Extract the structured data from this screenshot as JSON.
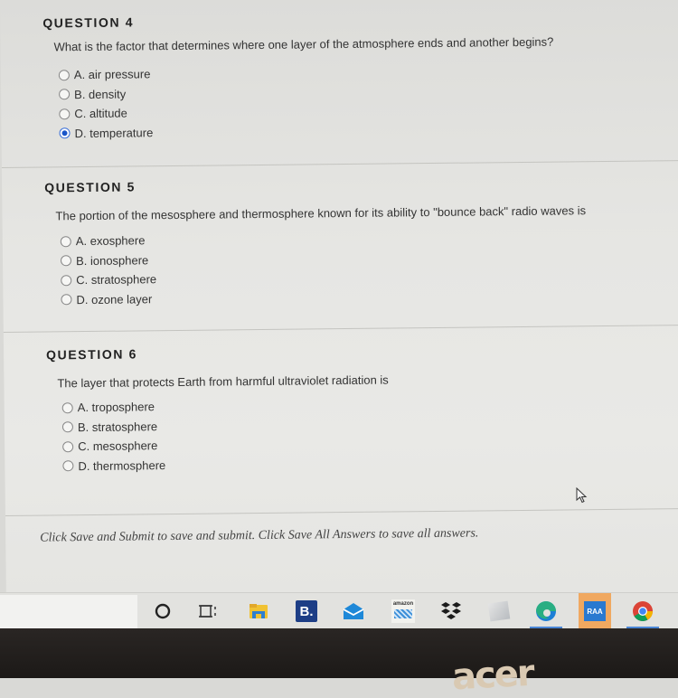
{
  "questions": [
    {
      "title": "QUESTION 4",
      "text": "What is the factor that determines where one layer of the atmosphere ends and another begins?",
      "options": [
        {
          "label": "A. air pressure",
          "selected": false
        },
        {
          "label": "B. density",
          "selected": false
        },
        {
          "label": "C. altitude",
          "selected": false
        },
        {
          "label": "D. temperature",
          "selected": true
        }
      ]
    },
    {
      "title": "QUESTION 5",
      "text": "The portion of the mesosphere and thermosphere known for its ability to \"bounce back\" radio waves is",
      "options": [
        {
          "label": "A. exosphere",
          "selected": false
        },
        {
          "label": "B. ionosphere",
          "selected": false
        },
        {
          "label": "C. stratosphere",
          "selected": false
        },
        {
          "label": "D. ozone layer",
          "selected": false
        }
      ]
    },
    {
      "title": "QUESTION 6",
      "text": "The layer that protects Earth from harmful ultraviolet radiation is",
      "options": [
        {
          "label": "A. troposphere",
          "selected": false
        },
        {
          "label": "B. stratosphere",
          "selected": false
        },
        {
          "label": "C. mesosphere",
          "selected": false
        },
        {
          "label": "D. thermosphere",
          "selected": false
        }
      ]
    }
  ],
  "footer": {
    "instructions": "Click Save and Submit to save and submit. Click Save All Answers to save all answers."
  },
  "taskbar": {
    "icons": [
      "cortana-icon",
      "task-view-icon",
      "file-explorer-icon",
      "booking-icon",
      "mail-icon",
      "amazon-icon",
      "dropbox-icon",
      "generic-app-icon",
      "edge-icon",
      "raa-app-icon",
      "chrome-icon"
    ],
    "booking_letter": "B.",
    "amazon_label": "amazon",
    "raa_label": "RAA",
    "colors": {
      "accent": "#1a55c8",
      "booking": "#1d3e86",
      "mail": "#1e88d8",
      "raa_bg": "#f0a860",
      "raa_inner": "#2a79d0"
    }
  },
  "bezel": {
    "logo": "acer"
  }
}
